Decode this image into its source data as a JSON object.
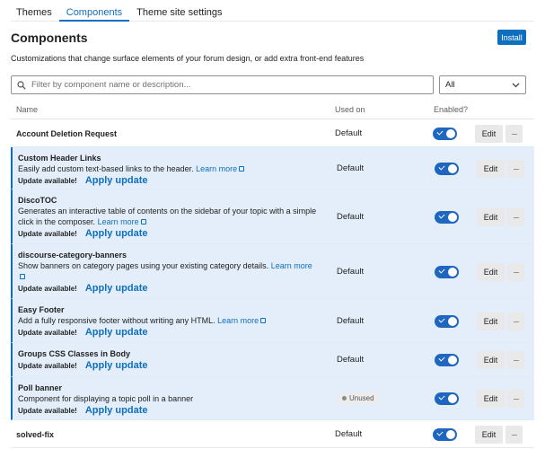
{
  "tabs": [
    {
      "label": "Themes",
      "active": false
    },
    {
      "label": "Components",
      "active": true
    },
    {
      "label": "Theme site settings",
      "active": false
    }
  ],
  "page": {
    "title": "Components",
    "install_label": "Install",
    "description": "Customizations that change surface elements of your forum design, or add extra front-end features"
  },
  "filter": {
    "placeholder": "Filter by component name or description...",
    "select_value": "All",
    "search_icon": "search-icon",
    "chevron_icon": "chevron-down-icon"
  },
  "table": {
    "headers": {
      "name": "Name",
      "used_on": "Used on",
      "enabled": "Enabled?"
    },
    "edit_label": "Edit",
    "more_label": "···",
    "update_available_label": "Update available!",
    "apply_update_label": "Apply update",
    "learn_more_label": "Learn more",
    "rows": [
      {
        "name": "Account Deletion Request",
        "desc": "",
        "learn_more": false,
        "update": false,
        "used_on": "Default",
        "unused": false
      },
      {
        "name": "Custom Header Links",
        "desc": "Easily add custom text-based links to the header.",
        "learn_more": true,
        "update": true,
        "used_on": "Default",
        "unused": false
      },
      {
        "name": "DiscoTOC",
        "desc": "Generates an interactive table of contents on the sidebar of your topic with a simple click in the composer.",
        "learn_more": true,
        "update": true,
        "used_on": "Default",
        "unused": false
      },
      {
        "name": "discourse-category-banners",
        "desc": "Show banners on category pages using your existing category details.",
        "learn_more": true,
        "update": true,
        "used_on": "Default",
        "unused": false
      },
      {
        "name": "Easy Footer",
        "desc": "Add a fully responsive footer without writing any HTML.",
        "learn_more": true,
        "update": true,
        "used_on": "Default",
        "unused": false
      },
      {
        "name": "Groups CSS Classes in Body",
        "desc": "",
        "learn_more": false,
        "update": true,
        "used_on": "Default",
        "unused": false
      },
      {
        "name": "Poll banner",
        "desc": "Component for displaying a topic poll in a banner",
        "learn_more": false,
        "update": true,
        "used_on": "Unused",
        "unused": true
      },
      {
        "name": "solved-fix",
        "desc": "",
        "learn_more": false,
        "update": false,
        "used_on": "Default",
        "unused": false
      }
    ]
  },
  "colors": {
    "accent": "#0f6fbf",
    "update_bg": "#e3eefa",
    "toggle_on": "#1f66c1"
  }
}
